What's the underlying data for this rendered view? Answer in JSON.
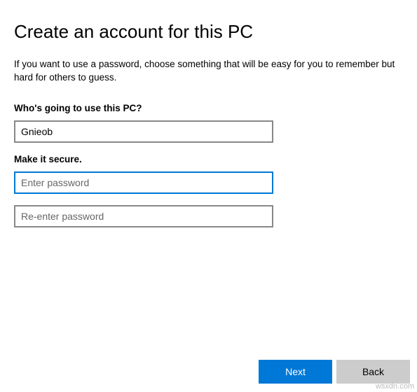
{
  "header": {
    "title": "Create an account for this PC",
    "description": "If you want to use a password, choose something that will be easy for you to remember but hard for others to guess."
  },
  "sections": {
    "username": {
      "label": "Who's going to use this PC?",
      "value": "Gnieob"
    },
    "password": {
      "label": "Make it secure.",
      "placeholder": "Enter password",
      "value": "",
      "confirm_placeholder": "Re-enter password",
      "confirm_value": ""
    }
  },
  "footer": {
    "next_label": "Next",
    "back_label": "Back"
  },
  "watermark": "wsxdn.com"
}
